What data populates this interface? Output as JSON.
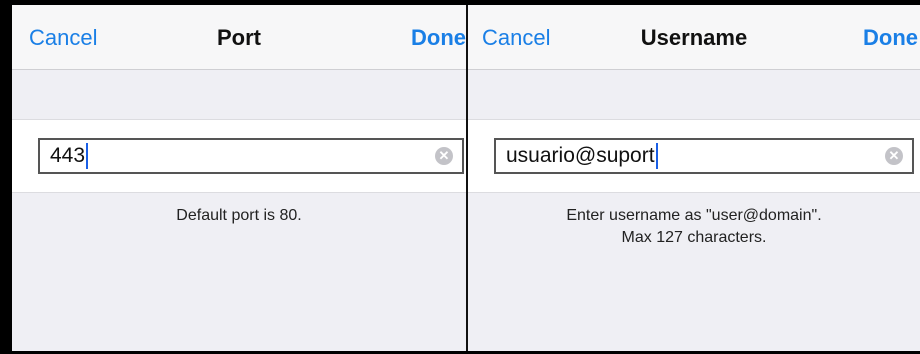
{
  "port_screen": {
    "nav": {
      "cancel": "Cancel",
      "title": "Port",
      "done": "Done"
    },
    "field_value": "443",
    "footer": [
      "Default port is 80."
    ]
  },
  "username_screen": {
    "nav": {
      "cancel": "Cancel",
      "title": "Username",
      "done": "Done"
    },
    "field_value": "usuario@suport",
    "footer": [
      "Enter username as \"user@domain\".",
      "Max 127 characters."
    ]
  },
  "icons": {
    "clear": "clear-field-icon"
  },
  "colors": {
    "accent": "#1a7fe6",
    "background": "#efeff4",
    "caret": "#1a5fe6"
  }
}
